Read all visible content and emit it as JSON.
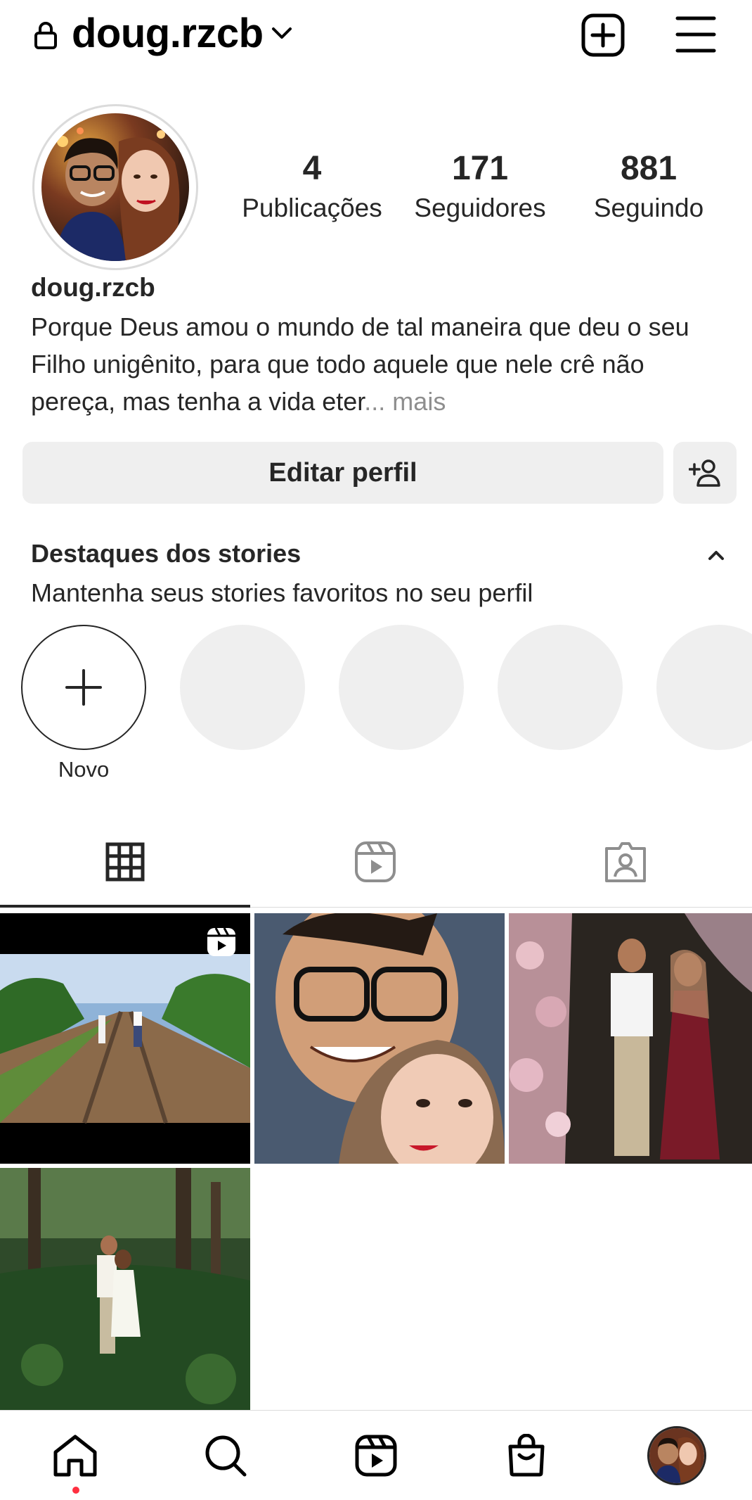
{
  "header": {
    "username": "doug.rzcb",
    "lock_icon": "lock-icon",
    "dropdown_icon": "chevron-down-icon",
    "new_post_icon": "plus-square-icon",
    "menu_icon": "hamburger-menu-icon"
  },
  "profile": {
    "name": "doug.rzcb",
    "bio": "Porque Deus amou o mundo de tal maneira que deu o seu Filho unigênito, para que todo aquele que nele crê não pereça, mas tenha a vida eter",
    "bio_more": "... mais",
    "stats": [
      {
        "value": "4",
        "label": "Publicações"
      },
      {
        "value": "171",
        "label": "Seguidores"
      },
      {
        "value": "881",
        "label": "Seguindo"
      }
    ],
    "edit_button": "Editar perfil",
    "add_user_icon": "add-person-icon"
  },
  "highlights": {
    "title": "Destaques dos stories",
    "subtitle": "Mantenha seus stories favoritos no seu perfil",
    "new_label": "Novo",
    "placeholder_count": 4
  },
  "tabs": [
    {
      "name": "posts-grid",
      "icon": "grid-icon",
      "active": true
    },
    {
      "name": "reels",
      "icon": "reels-icon",
      "active": false
    },
    {
      "name": "tagged",
      "icon": "tagged-person-icon",
      "active": false
    }
  ],
  "posts": [
    {
      "type": "reel",
      "description": "couple walking on railway tracks"
    },
    {
      "type": "photo",
      "description": "selfie of couple"
    },
    {
      "type": "photo",
      "description": "couple at formal event with flowers"
    },
    {
      "type": "photo",
      "description": "couple embracing in forest"
    }
  ],
  "bottom_nav": [
    {
      "name": "home",
      "icon": "home-icon",
      "has_notification": true
    },
    {
      "name": "search",
      "icon": "search-icon"
    },
    {
      "name": "reels",
      "icon": "reels-icon"
    },
    {
      "name": "shop",
      "icon": "shopping-bag-icon"
    },
    {
      "name": "profile",
      "icon": "avatar"
    }
  ],
  "colors": {
    "text": "#262626",
    "secondary": "#8e8e8e",
    "button_bg": "#efefef",
    "divider": "#dbdbdb",
    "notification": "#ff3040"
  }
}
